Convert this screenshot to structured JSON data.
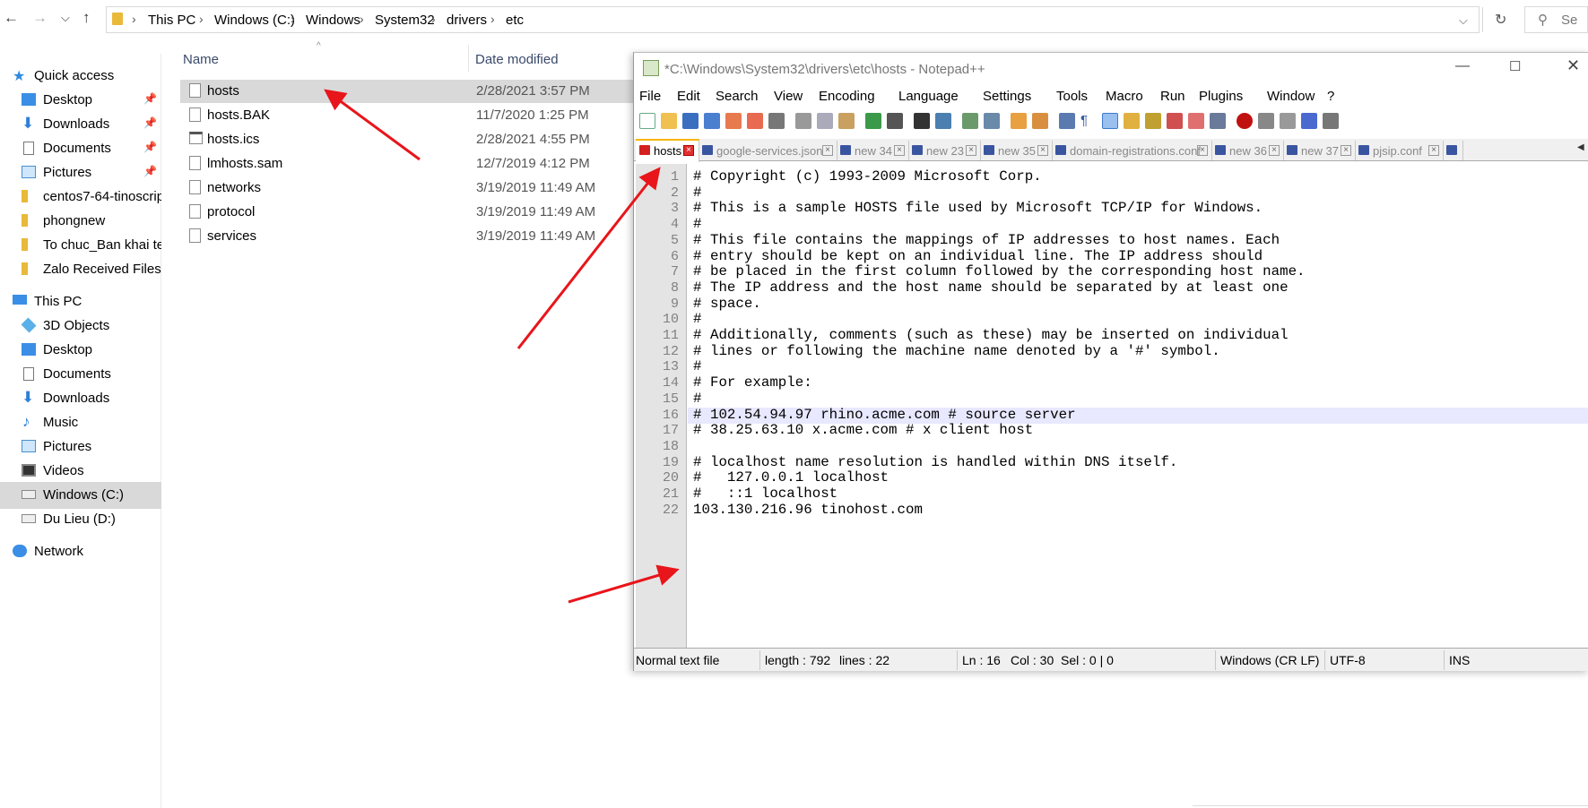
{
  "explorer": {
    "nav": {
      "back_icon": "arrow-left-icon",
      "forward_icon": "arrow-right-icon",
      "recent_icon": "chevron-down-icon",
      "up_icon": "arrow-up-icon"
    },
    "breadcrumb": [
      "This PC",
      "Windows (C:)",
      "Windows",
      "System32",
      "drivers",
      "etc"
    ],
    "search_placeholder": "Se",
    "sidebar": [
      {
        "label": "Quick access",
        "icon": "star-icon",
        "pinned": false
      },
      {
        "label": "Desktop",
        "icon": "desktop-icon",
        "pinned": true
      },
      {
        "label": "Downloads",
        "icon": "download-icon",
        "pinned": true
      },
      {
        "label": "Documents",
        "icon": "document-icon",
        "pinned": true
      },
      {
        "label": "Pictures",
        "icon": "pictures-icon",
        "pinned": true
      },
      {
        "label": "centos7-64-tinoscrip",
        "icon": "folder-icon",
        "pinned": false
      },
      {
        "label": "phongnew",
        "icon": "folder-icon",
        "pinned": false
      },
      {
        "label": "To chuc_Ban khai te",
        "icon": "folder-icon",
        "pinned": false
      },
      {
        "label": "Zalo Received Files",
        "icon": "folder-icon",
        "pinned": false
      },
      {
        "label": "This PC",
        "icon": "computer-icon",
        "pinned": false
      },
      {
        "label": "3D Objects",
        "icon": "cube-icon",
        "pinned": false
      },
      {
        "label": "Desktop",
        "icon": "desktop-icon",
        "pinned": false
      },
      {
        "label": "Documents",
        "icon": "document-icon",
        "pinned": false
      },
      {
        "label": "Downloads",
        "icon": "download-icon",
        "pinned": false
      },
      {
        "label": "Music",
        "icon": "music-icon",
        "pinned": false
      },
      {
        "label": "Pictures",
        "icon": "pictures-icon",
        "pinned": false
      },
      {
        "label": "Videos",
        "icon": "video-icon",
        "pinned": false
      },
      {
        "label": "Windows (C:)",
        "icon": "drive-icon",
        "pinned": false
      },
      {
        "label": "Du Lieu (D:)",
        "icon": "drive-icon",
        "pinned": false
      },
      {
        "label": "Network",
        "icon": "network-icon",
        "pinned": false
      }
    ],
    "columns": {
      "name": "Name",
      "date": "Date modified"
    },
    "files": [
      {
        "name": "hosts",
        "date": "2/28/2021 3:57 PM"
      },
      {
        "name": "hosts.BAK",
        "date": "11/7/2020 1:25 PM"
      },
      {
        "name": "hosts.ics",
        "date": "2/28/2021 4:55 PM"
      },
      {
        "name": "lmhosts.sam",
        "date": "12/7/2019 4:12 PM"
      },
      {
        "name": "networks",
        "date": "3/19/2019 11:49 AM"
      },
      {
        "name": "protocol",
        "date": "3/19/2019 11:49 AM"
      },
      {
        "name": "services",
        "date": "3/19/2019 11:49 AM"
      }
    ]
  },
  "npp": {
    "title": "*C:\\Windows\\System32\\drivers\\etc\\hosts - Notepad++",
    "menu": [
      "File",
      "Edit",
      "Search",
      "View",
      "Encoding",
      "Language",
      "Settings",
      "Tools",
      "Macro",
      "Run",
      "Plugins",
      "Window",
      "?"
    ],
    "tabs": [
      "hosts",
      "google-services.json",
      "new 34",
      "new 23",
      "new 35",
      "domain-registrations.conf",
      "new 36",
      "new 37",
      "pjsip.conf"
    ],
    "lines": [
      "# Copyright (c) 1993-2009 Microsoft Corp.",
      "#",
      "# This is a sample HOSTS file used by Microsoft TCP/IP for Windows.",
      "#",
      "# This file contains the mappings of IP addresses to host names. Each",
      "# entry should be kept on an individual line. The IP address should",
      "# be placed in the first column followed by the corresponding host name.",
      "# The IP address and the host name should be separated by at least one",
      "# space.",
      "#",
      "# Additionally, comments (such as these) may be inserted on individual",
      "# lines or following the machine name denoted by a '#' symbol.",
      "#",
      "# For example:",
      "#",
      "# 102.54.94.97 rhino.acme.com # source server",
      "# 38.25.63.10 x.acme.com # x client host",
      "",
      "# localhost name resolution is handled within DNS itself.",
      "#   127.0.0.1 localhost",
      "#   ::1 localhost",
      "103.130.216.96 tinohost.com"
    ],
    "line_numbers": [
      "1",
      "2",
      "3",
      "4",
      "5",
      "6",
      "7",
      "8",
      "9",
      "10",
      "11",
      "12",
      "13",
      "14",
      "15",
      "16",
      "17",
      "18",
      "19",
      "20",
      "21",
      "22"
    ],
    "status": {
      "type": "Normal text file",
      "length": "length : 792",
      "lines": "lines : 22",
      "ln": "Ln : 16",
      "col": "Col : 30",
      "sel": "Sel : 0 | 0",
      "eol": "Windows (CR LF)",
      "encoding": "UTF-8",
      "mode": "INS"
    }
  },
  "colors": {
    "arrow": "#e8151b",
    "selection": "#d9d9d9",
    "current_line": "#e8e8ff",
    "tab_accent": "#f7b500"
  }
}
